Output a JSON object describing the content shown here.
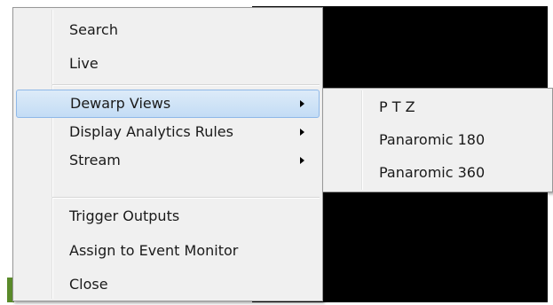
{
  "context_menu": {
    "items": [
      {
        "label": "Search"
      },
      {
        "label": "Live"
      },
      {
        "label": "Dewarp Views"
      },
      {
        "label": "Display Analytics Rules"
      },
      {
        "label": "Stream"
      },
      {
        "label": "Trigger Outputs"
      },
      {
        "label": "Assign to Event Monitor"
      },
      {
        "label": "Close"
      }
    ],
    "submenu_arrow_icon": "chevron-right-icon"
  },
  "dewarp_submenu": {
    "items": [
      {
        "label": "P T Z"
      },
      {
        "label": "Panaromic 180"
      },
      {
        "label": "Panaromic 360"
      }
    ]
  },
  "colors": {
    "menu_background": "#f0f0f0",
    "highlight": "#c3dcf5",
    "video_background": "#000000"
  }
}
